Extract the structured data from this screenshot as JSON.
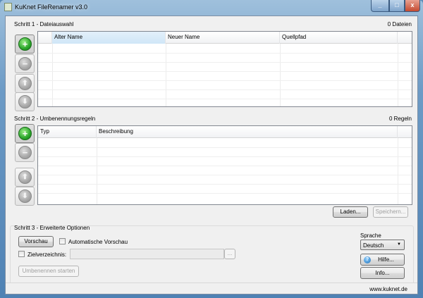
{
  "window": {
    "title": "KuKnet FileRenamer v3.0",
    "minimize": "_",
    "maximize": "□",
    "close": "x"
  },
  "step1": {
    "label": "Schritt 1 - Dateiauswahl",
    "count": "0 Dateien",
    "columns": [
      "Alter Name",
      "Neuer Name",
      "Quellpfad"
    ]
  },
  "step2": {
    "label": "Schritt 2 - Umbenennungsregeln",
    "count": "0 Regeln",
    "columns": [
      "Typ",
      "Beschreibung"
    ],
    "load": "Laden...",
    "save": "Speichern..."
  },
  "step3": {
    "label": "Schritt 3 - Erweiterte Optionen",
    "preview": "Vorschau",
    "auto_preview": "Automatische Vorschau",
    "target_dir": "Zielverzeichnis:",
    "target_value": "",
    "browse": "...",
    "start": "Umbenennen starten",
    "language_label": "Sprache",
    "language": "Deutsch",
    "help": "Hilfe...",
    "info": "Info..."
  },
  "icons": {
    "add": "+",
    "remove": "−",
    "up": "⬆",
    "down": "⬇",
    "dropdown": "▼",
    "help": "?"
  },
  "status": {
    "url": "www.kuknet.de"
  }
}
